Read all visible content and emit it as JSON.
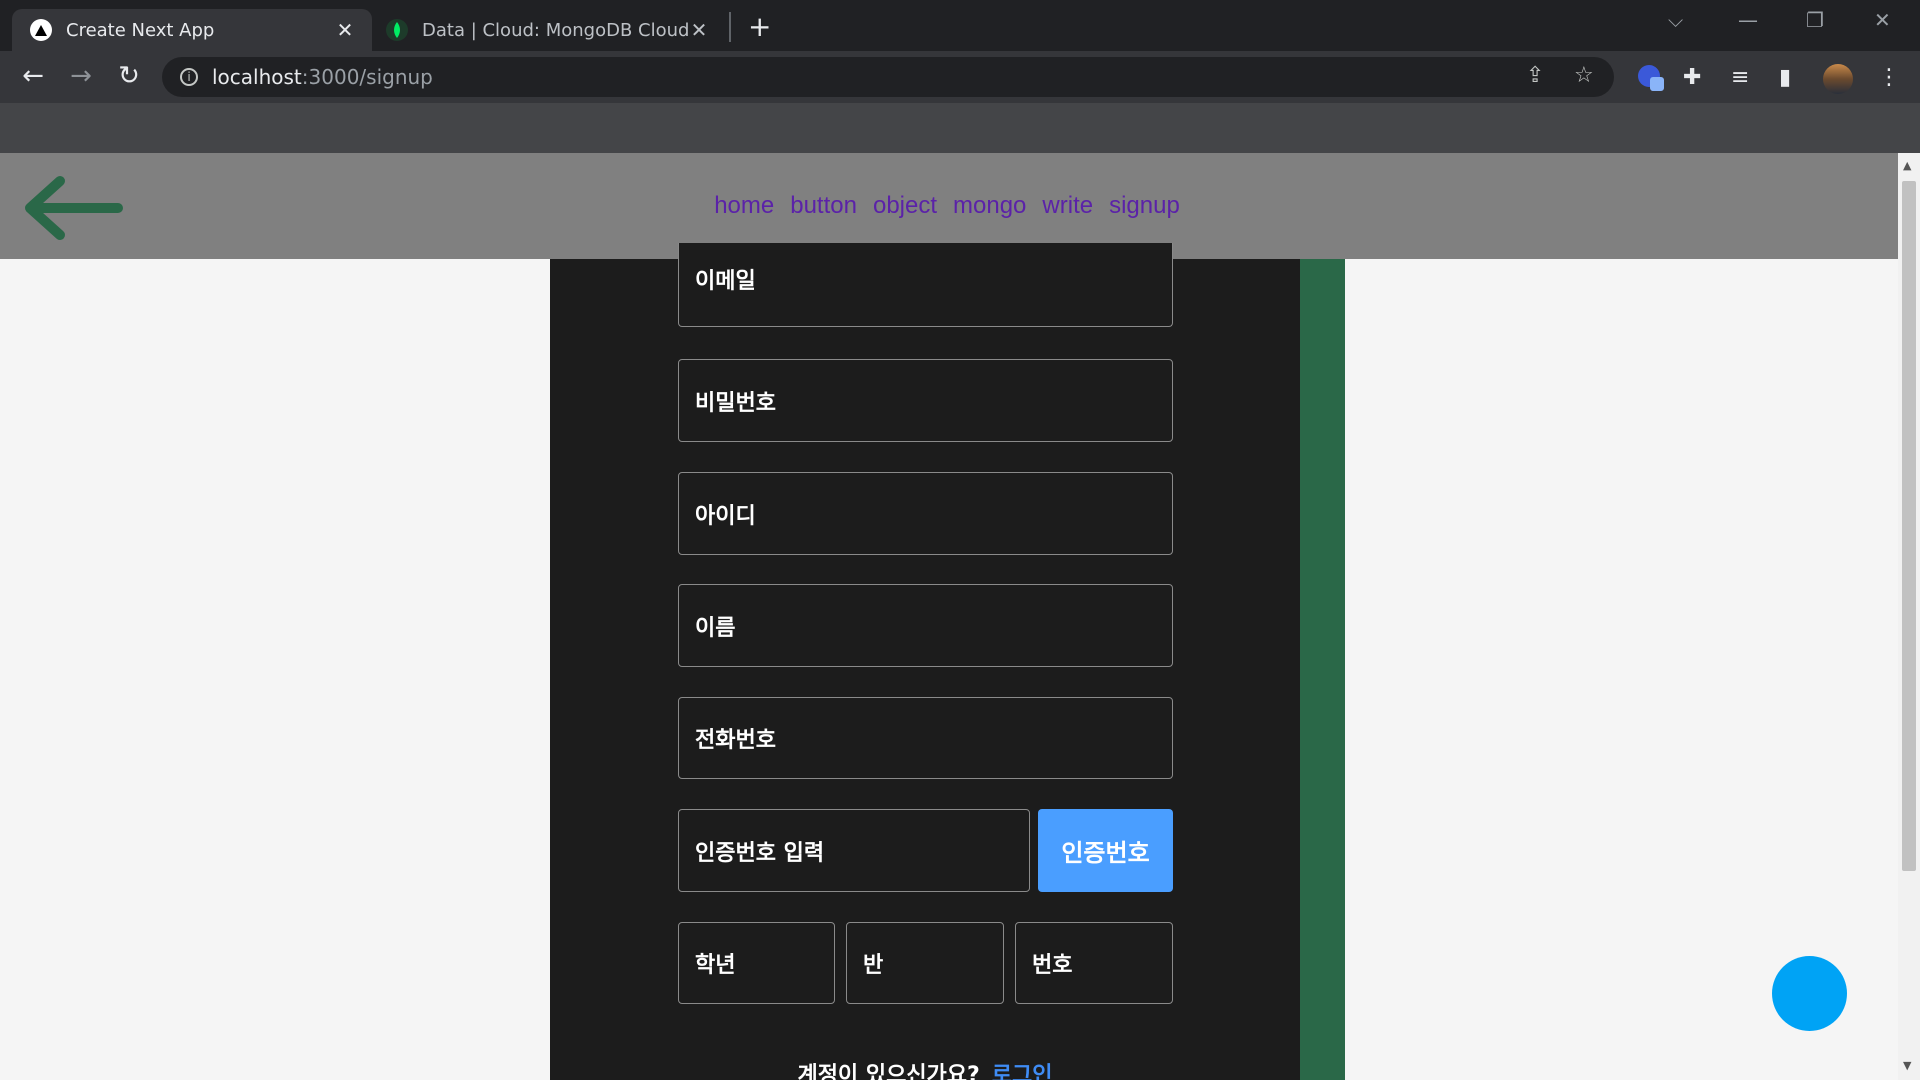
{
  "browser": {
    "tabs": [
      {
        "title": "Create Next App",
        "active": true,
        "icon": "nextjs-triangle-icon"
      },
      {
        "title": "Data | Cloud: MongoDB Cloud",
        "active": false,
        "icon": "mongodb-leaf-icon"
      }
    ],
    "url_host": "localhost",
    "url_path": ":3000/signup"
  },
  "nav": {
    "links": [
      "home",
      "button",
      "object",
      "mongo",
      "write",
      "signup"
    ]
  },
  "form": {
    "email": "이메일",
    "password": "비밀번호",
    "user_id": "아이디",
    "name": "이름",
    "phone": "전화번호",
    "verify_code": "인증번호 입력",
    "verify_button": "인증번호",
    "grade": "학년",
    "class": "반",
    "number": "번호"
  },
  "footer": {
    "question": "계정이 있으신가요?",
    "login_link": "로그인"
  },
  "colors": {
    "panel": "#1c1c1c",
    "strip": "#2a6848",
    "button": "#4a9eff",
    "fab": "#00a3f5",
    "nav_link": "#5b22a8"
  }
}
